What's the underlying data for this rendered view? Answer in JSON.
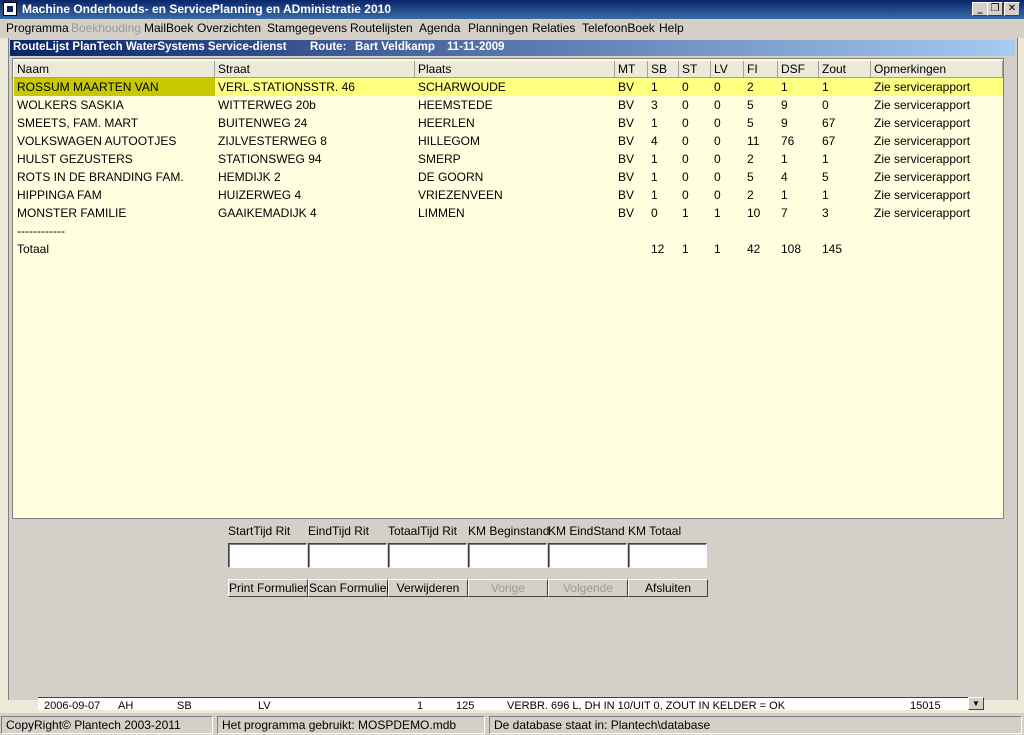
{
  "window": {
    "title": "Machine Onderhouds- en ServicePlanning  en ADministratie  2010",
    "controls": {
      "minimize": "_",
      "maximize": "❐",
      "close": "✕"
    }
  },
  "menu": [
    {
      "label": "Programma",
      "disabled": false
    },
    {
      "label": "Boekhouding",
      "disabled": true
    },
    {
      "label": "MailBoek",
      "disabled": false
    },
    {
      "label": "Overzichten",
      "disabled": false
    },
    {
      "label": "Stamgegevens",
      "disabled": false
    },
    {
      "label": "Routelijsten",
      "disabled": false
    },
    {
      "label": "Agenda",
      "disabled": false
    },
    {
      "label": "Planningen",
      "disabled": false
    },
    {
      "label": "Relaties",
      "disabled": false
    },
    {
      "label": "TelefoonBoek",
      "disabled": false
    },
    {
      "label": "Help",
      "disabled": false
    }
  ],
  "subtitle": {
    "left": "RouteLijst PlanTech WaterSystems Service-dienst",
    "route_label": "Route:",
    "route_value": "Bart Veldkamp",
    "date": "11-11-2009"
  },
  "grid": {
    "columns": [
      "Naam",
      "Straat",
      "Plaats",
      "MT",
      "SB",
      "ST",
      "LV",
      "FI",
      "DSF",
      "Zout",
      "Opmerkingen"
    ],
    "rows": [
      [
        "ROSSUM MAARTEN VAN",
        "VERL.STATIONSSTR. 46",
        "SCHARWOUDE",
        "BV",
        "1",
        "0",
        "0",
        "2",
        "1",
        "1",
        "Zie servicerapport"
      ],
      [
        "WOLKERS SASKIA",
        "WITTERWEG 20b",
        "HEEMSTEDE",
        "BV",
        "3",
        "0",
        "0",
        "5",
        "9",
        "0",
        "Zie servicerapport"
      ],
      [
        "SMEETS, FAM. MART",
        "BUITENWEG 24",
        "HEERLEN",
        "BV",
        "1",
        "0",
        "0",
        "5",
        "9",
        "67",
        "Zie servicerapport"
      ],
      [
        "VOLKSWAGEN AUTOOTJES",
        "ZIJLVESTERWEG 8",
        "HILLEGOM",
        "BV",
        "4",
        "0",
        "0",
        "11",
        "76",
        "67",
        "Zie servicerapport"
      ],
      [
        "HULST GEZUSTERS",
        "STATIONSWEG 94",
        "SMERP",
        "BV",
        "1",
        "0",
        "0",
        "2",
        "1",
        "1",
        "Zie servicerapport"
      ],
      [
        "ROTS IN DE BRANDING FAM.",
        "HEMDIJK 2",
        "DE GOORN",
        "BV",
        "1",
        "0",
        "0",
        "5",
        "4",
        "5",
        "Zie servicerapport"
      ],
      [
        "HIPPINGA FAM",
        "HUIZERWEG 4",
        "VRIEZENVEEN",
        "BV",
        "1",
        "0",
        "0",
        "2",
        "1",
        "1",
        "Zie servicerapport"
      ],
      [
        "MONSTER FAMILIE",
        "GAAIKEMADIJK 4",
        "LIMMEN",
        "BV",
        "0",
        "1",
        "1",
        "10",
        "7",
        "3",
        "Zie servicerapport"
      ],
      [
        "------------",
        "",
        "",
        "",
        "",
        "",
        "",
        "",
        "",
        "",
        ""
      ],
      [
        "Totaal",
        "",
        "",
        "",
        "12",
        "1",
        "1",
        "42",
        "108",
        "145",
        ""
      ]
    ]
  },
  "trip": {
    "fields": [
      {
        "label": "StartTijd Rit",
        "value": ""
      },
      {
        "label": "EindTijd Rit",
        "value": ""
      },
      {
        "label": "TotaalTijd Rit",
        "value": ""
      },
      {
        "label": "KM Beginstand",
        "value": ""
      },
      {
        "label": "KM EindStand",
        "value": ""
      },
      {
        "label": "KM Totaal",
        "value": ""
      }
    ]
  },
  "buttons": [
    {
      "label": "Print Formulier",
      "disabled": false
    },
    {
      "label": "Scan Formulier",
      "disabled": false
    },
    {
      "label": "Verwijderen",
      "disabled": false
    },
    {
      "label": "Vorige",
      "disabled": true
    },
    {
      "label": "Volgende",
      "disabled": true
    },
    {
      "label": "Afsluiten",
      "disabled": false
    }
  ],
  "bottom_list": {
    "items": [
      "2006-09-07",
      "AH",
      "SB",
      "LV",
      "1",
      "125",
      "VERBR. 696 L, DH IN 10/UIT 0, ZOUT IN KELDER = OK",
      "15015"
    ],
    "arrow": "▼"
  },
  "status": {
    "copyright": "CopyRight© Plantech 2003-2011",
    "program": "Het programma gebruikt: MOSPDEMO.mdb",
    "database": "De database staat in: Plantech\\database"
  }
}
